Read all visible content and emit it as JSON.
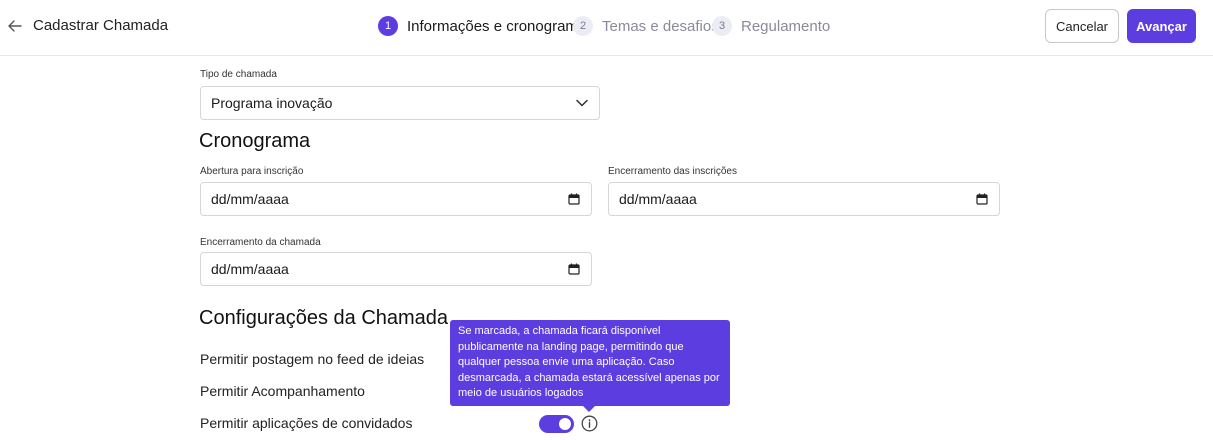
{
  "header": {
    "title": "Cadastrar Chamada",
    "steps": [
      {
        "number": "1",
        "label": "Informações e cronograma",
        "active": true
      },
      {
        "number": "2",
        "label": "Temas e desafios",
        "active": false
      },
      {
        "number": "3",
        "label": "Regulamento",
        "active": false
      }
    ],
    "cancel_label": "Cancelar",
    "next_label": "Avançar"
  },
  "form": {
    "tipo": {
      "label": "Tipo de chamada",
      "value": "Programa inovação"
    },
    "cronograma_title": "Cronograma",
    "abertura": {
      "label": "Abertura para inscrição",
      "value": "dd/mm/aaaa"
    },
    "encerramento_inscricoes": {
      "label": "Encerramento das inscrições",
      "value": "dd/mm/aaaa"
    },
    "encerramento_chamada": {
      "label": "Encerramento da chamada",
      "value": "dd/mm/aaaa"
    },
    "config_title": "Configurações da Chamada",
    "settings": [
      {
        "label": "Permitir postagem no feed de ideias"
      },
      {
        "label": "Permitir Acompanhamento"
      },
      {
        "label": "Permitir aplicações de convidados",
        "enabled": true
      }
    ],
    "tooltip_text": "Se marcada, a chamada ficará disponível publicamente na landing page, permitindo que qualquer pessoa envie uma aplicação. Caso desmarcada, a chamada estará acessível apenas por meio de usuários logados"
  },
  "colors": {
    "accent": "#5b3de0",
    "border": "#d6d6d6"
  },
  "icons": [
    "arrow-left-icon",
    "chevron-down-icon",
    "calendar-icon",
    "info-icon"
  ]
}
